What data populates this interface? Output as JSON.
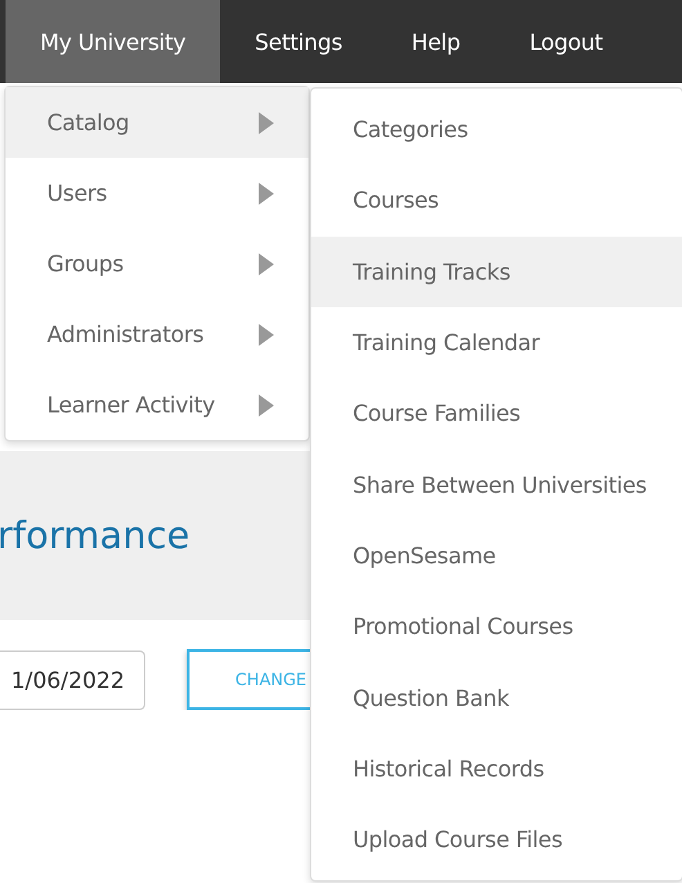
{
  "nav": [
    {
      "label": "My University",
      "selected": true
    },
    {
      "label": "Settings",
      "selected": false
    },
    {
      "label": "Help",
      "selected": false
    },
    {
      "label": "Logout",
      "selected": false
    }
  ],
  "dropdown": [
    {
      "label": "Catalog",
      "selected": true,
      "submenu": true
    },
    {
      "label": "Users",
      "selected": false,
      "submenu": true
    },
    {
      "label": "Groups",
      "selected": false,
      "submenu": true
    },
    {
      "label": "Administrators",
      "selected": false,
      "submenu": true
    },
    {
      "label": "Learner Activity",
      "selected": false,
      "submenu": true
    }
  ],
  "submenu": [
    {
      "label": "Categories",
      "selected": false
    },
    {
      "label": "Courses",
      "selected": false
    },
    {
      "label": "Training Tracks",
      "selected": true
    },
    {
      "label": "Training Calendar",
      "selected": false
    },
    {
      "label": "Course Families",
      "selected": false
    },
    {
      "label": "Share Between Universities",
      "selected": false
    },
    {
      "label": "OpenSesame",
      "selected": false
    },
    {
      "label": "Promotional Courses",
      "selected": false
    },
    {
      "label": "Question Bank",
      "selected": false
    },
    {
      "label": "Historical Records",
      "selected": false
    },
    {
      "label": "Upload Course Files",
      "selected": false
    }
  ],
  "page": {
    "heading": "rformance",
    "date_field": "1/06/2022",
    "button": "CHANGE"
  }
}
